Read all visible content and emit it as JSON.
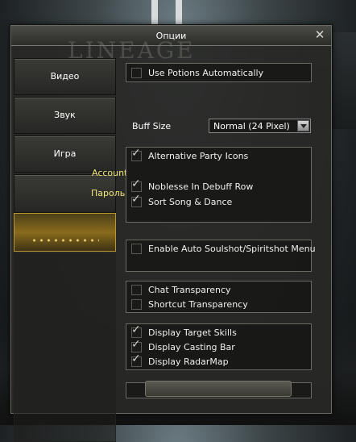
{
  "window": {
    "title": "Опции",
    "watermark": "LINEAGE"
  },
  "sidebar": {
    "items": [
      {
        "label": "Видео"
      },
      {
        "label": "Звук"
      },
      {
        "label": "Игра"
      }
    ],
    "subitems": [
      {
        "label": "Account"
      },
      {
        "label": "Пароль"
      }
    ]
  },
  "options": {
    "use_potions": {
      "label": "Use Potions Automatically",
      "checked": false
    },
    "buff_size": {
      "label": "Buff Size",
      "value": "Normal (24 Pixel)"
    },
    "party_icons": {
      "label": "Alternative Party Icons",
      "checked": true
    },
    "noblesse": {
      "label": "Noblesse In Debuff Row",
      "checked": true
    },
    "sort_song": {
      "label": "Sort Song & Dance",
      "checked": true
    },
    "soulshot": {
      "label": "Enable Auto Soulshot/Spiritshot Menu",
      "checked": false
    },
    "chat_transparency": {
      "label": "Chat Transparency",
      "checked": false
    },
    "shortcut_transparency": {
      "label": "Shortcut Transparency",
      "checked": false
    },
    "target_skills": {
      "label": "Display Target Skills",
      "checked": true
    },
    "casting_bar": {
      "label": "Display Casting Bar",
      "checked": true
    },
    "radarmap": {
      "label": "Display RadarMap",
      "checked": true
    }
  }
}
